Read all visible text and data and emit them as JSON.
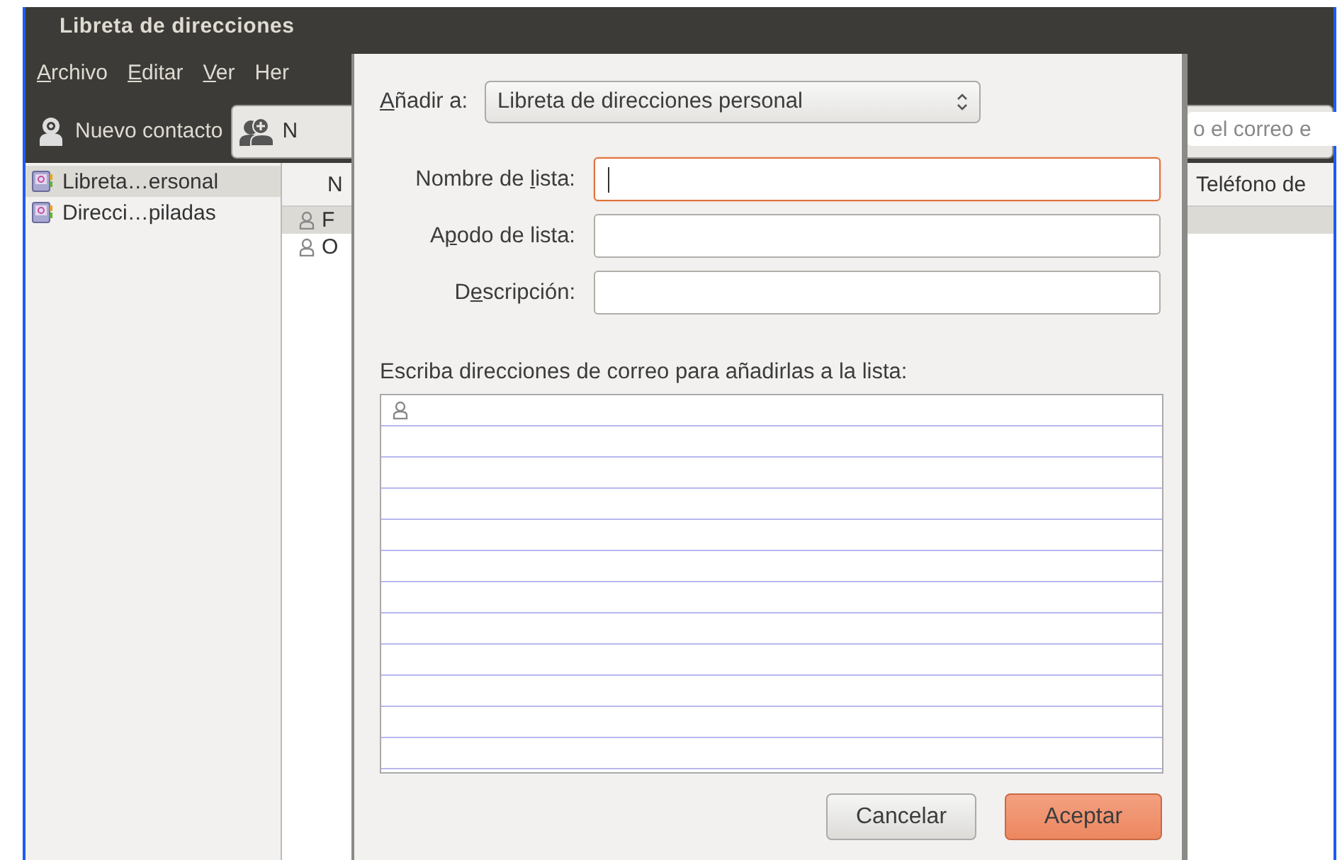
{
  "window": {
    "title": "Libreta de direcciones"
  },
  "menu": [
    {
      "parts": {
        "key": "A",
        "after": "rchivo"
      }
    },
    {
      "parts": {
        "key": "E",
        "after": "ditar"
      }
    },
    {
      "parts": {
        "key": "V",
        "after": "er"
      }
    },
    {
      "parts": {
        "before": "Her"
      }
    }
  ],
  "toolbar": {
    "buttons": [
      {
        "label": "Nuevo contacto",
        "kind": "contact"
      },
      {
        "label": "N",
        "kind": "list"
      }
    ],
    "search": {
      "placeholder": "o el correo e"
    }
  },
  "sidebar": {
    "items": [
      {
        "label": "Libreta…ersonal",
        "selected": true
      },
      {
        "label": "Direcci…piladas",
        "selected": false
      }
    ]
  },
  "contacts": {
    "columns": [
      "N",
      "Teléfono de"
    ],
    "rows": [
      {
        "name": "F",
        "selected": true
      },
      {
        "name": "O",
        "selected": false
      }
    ]
  },
  "dialog": {
    "add_to": {
      "label_parts": {
        "key": "A",
        "after": "ñadir a:"
      },
      "value": "Libreta de direcciones personal"
    },
    "fields": [
      {
        "label_parts": {
          "before": "Nombre de ",
          "key": "l",
          "after": "ista:"
        },
        "focused": true
      },
      {
        "label_parts": {
          "before": "A",
          "key": "p",
          "after": "odo de lista:"
        },
        "focused": false
      },
      {
        "label_parts": {
          "before": "D",
          "key": "e",
          "after": "scripción:"
        },
        "focused": false
      }
    ],
    "address_list": {
      "label": "Escriba direcciones de correo para añadirlas a la lista:"
    },
    "buttons": [
      {
        "label": "Cancelar",
        "kind": "secondary"
      },
      {
        "label": "Aceptar",
        "kind": "primary"
      }
    ]
  }
}
